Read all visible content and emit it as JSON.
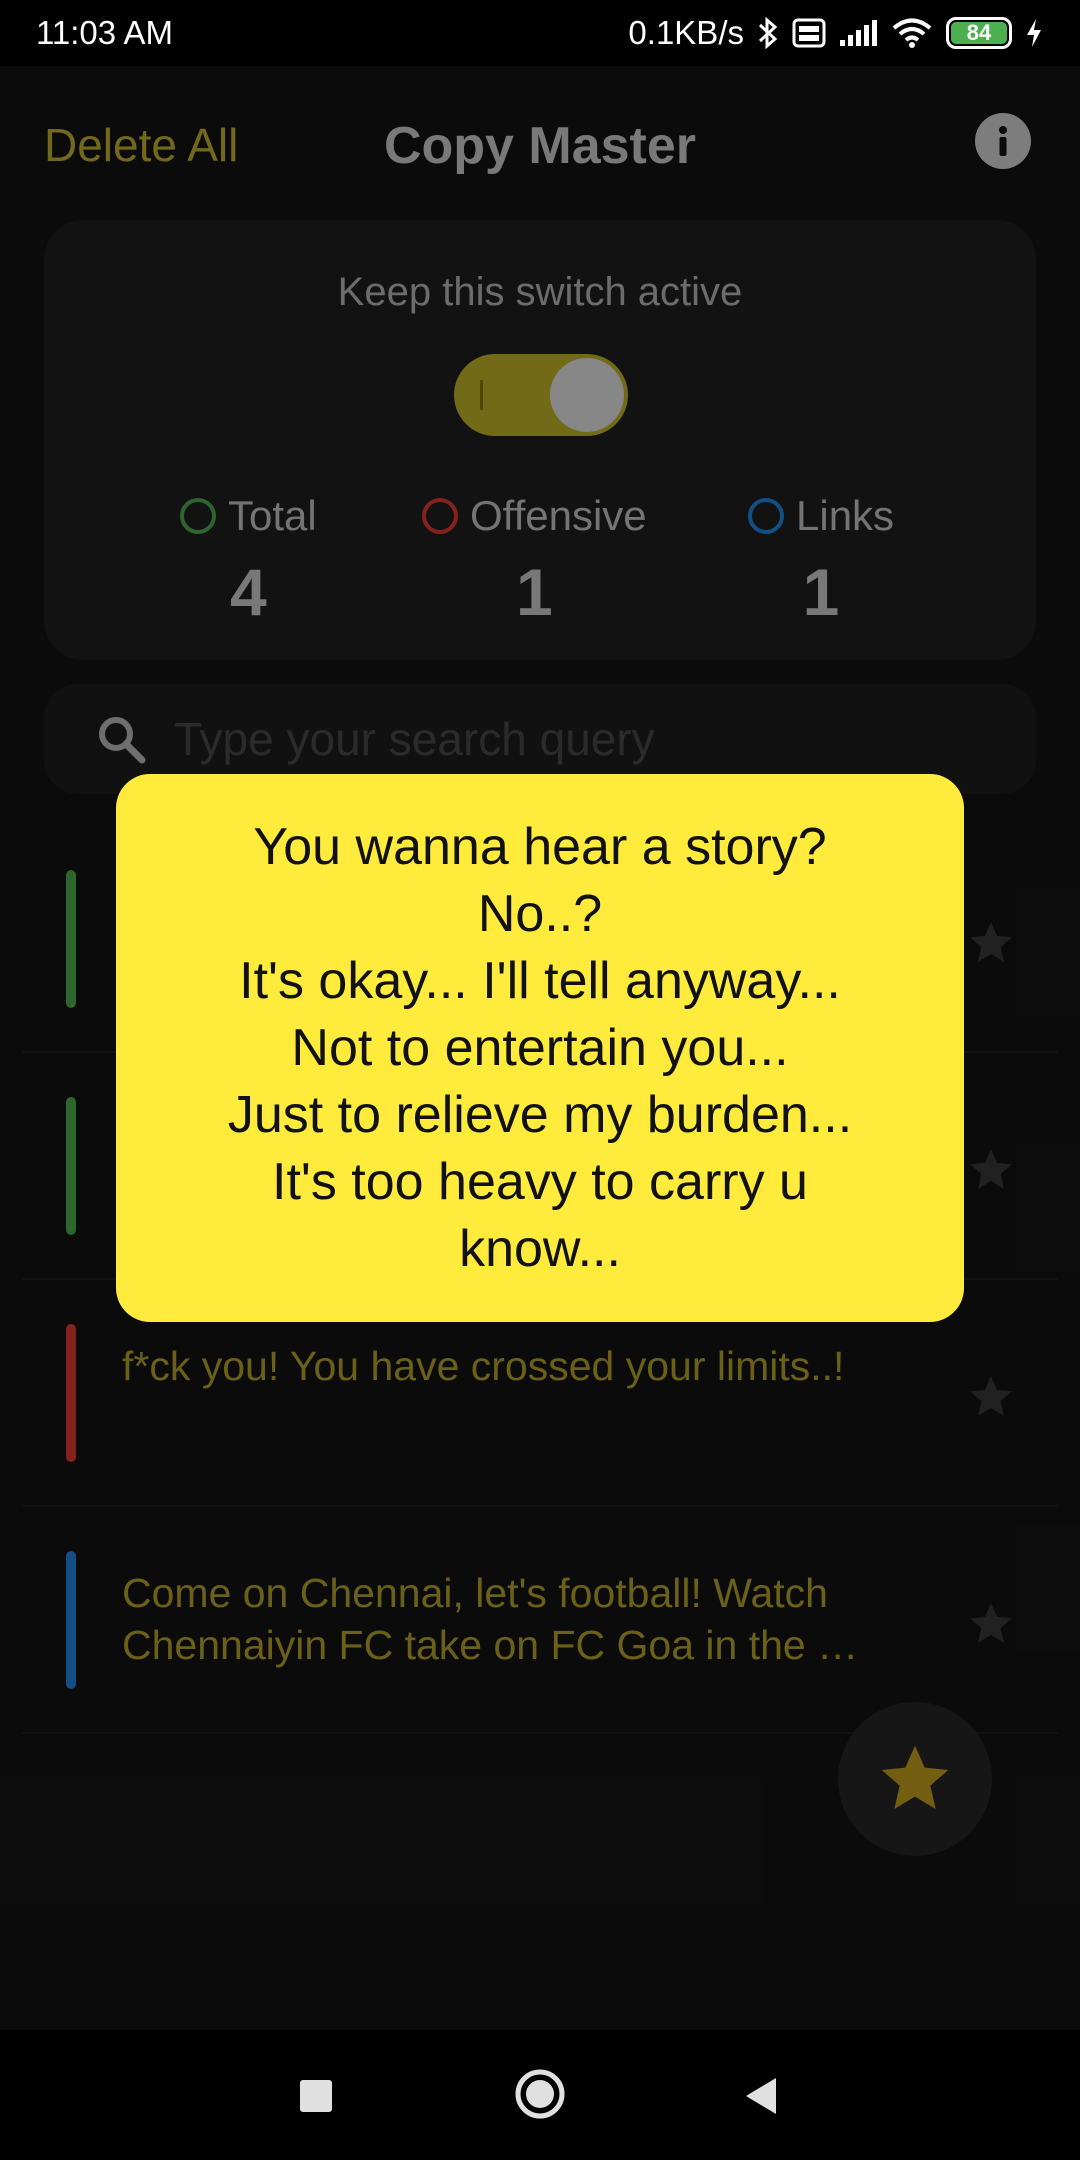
{
  "status_bar": {
    "time": "11:03 AM",
    "speed": "0.1KB/s",
    "battery": "84",
    "icons": [
      "bluetooth-icon",
      "volte-icon",
      "signal-icon",
      "wifi-icon",
      "battery-icon",
      "charging-icon"
    ]
  },
  "app_bar": {
    "delete_all": "Delete All",
    "title": "Copy Master",
    "info_icon": "info-icon"
  },
  "stats_card": {
    "caption": "Keep this switch active",
    "switch_on": true,
    "stats": [
      {
        "label": "Total",
        "value": "4",
        "color": "#4caf50"
      },
      {
        "label": "Offensive",
        "value": "1",
        "color": "#e53935"
      },
      {
        "label": "Links",
        "value": "1",
        "color": "#1e88e5"
      }
    ]
  },
  "search": {
    "placeholder": "Type your search query"
  },
  "list": {
    "items": [
      {
        "text": "",
        "color": "#4caf50",
        "starred": false
      },
      {
        "text": "",
        "color": "#4caf50",
        "starred": false
      },
      {
        "text": "f*ck you! You have crossed your limits..!",
        "color": "#e53935",
        "starred": false
      },
      {
        "text": "Come on Chennai, let's football! Watch Chennaiyin FC take on FC Goa in the …",
        "color": "#1e88e5",
        "starred": false
      }
    ]
  },
  "fab": {
    "icon": "star-icon"
  },
  "dialog": {
    "text": "You wanna hear a story?\nNo..?\nIt's okay... I'll tell anyway...\nNot to entertain you...\nJust to relieve my burden...\nIt's too heavy to carry u\nknow..."
  },
  "nav_bar": {
    "icons": [
      "recents-icon",
      "home-icon",
      "back-icon"
    ]
  }
}
